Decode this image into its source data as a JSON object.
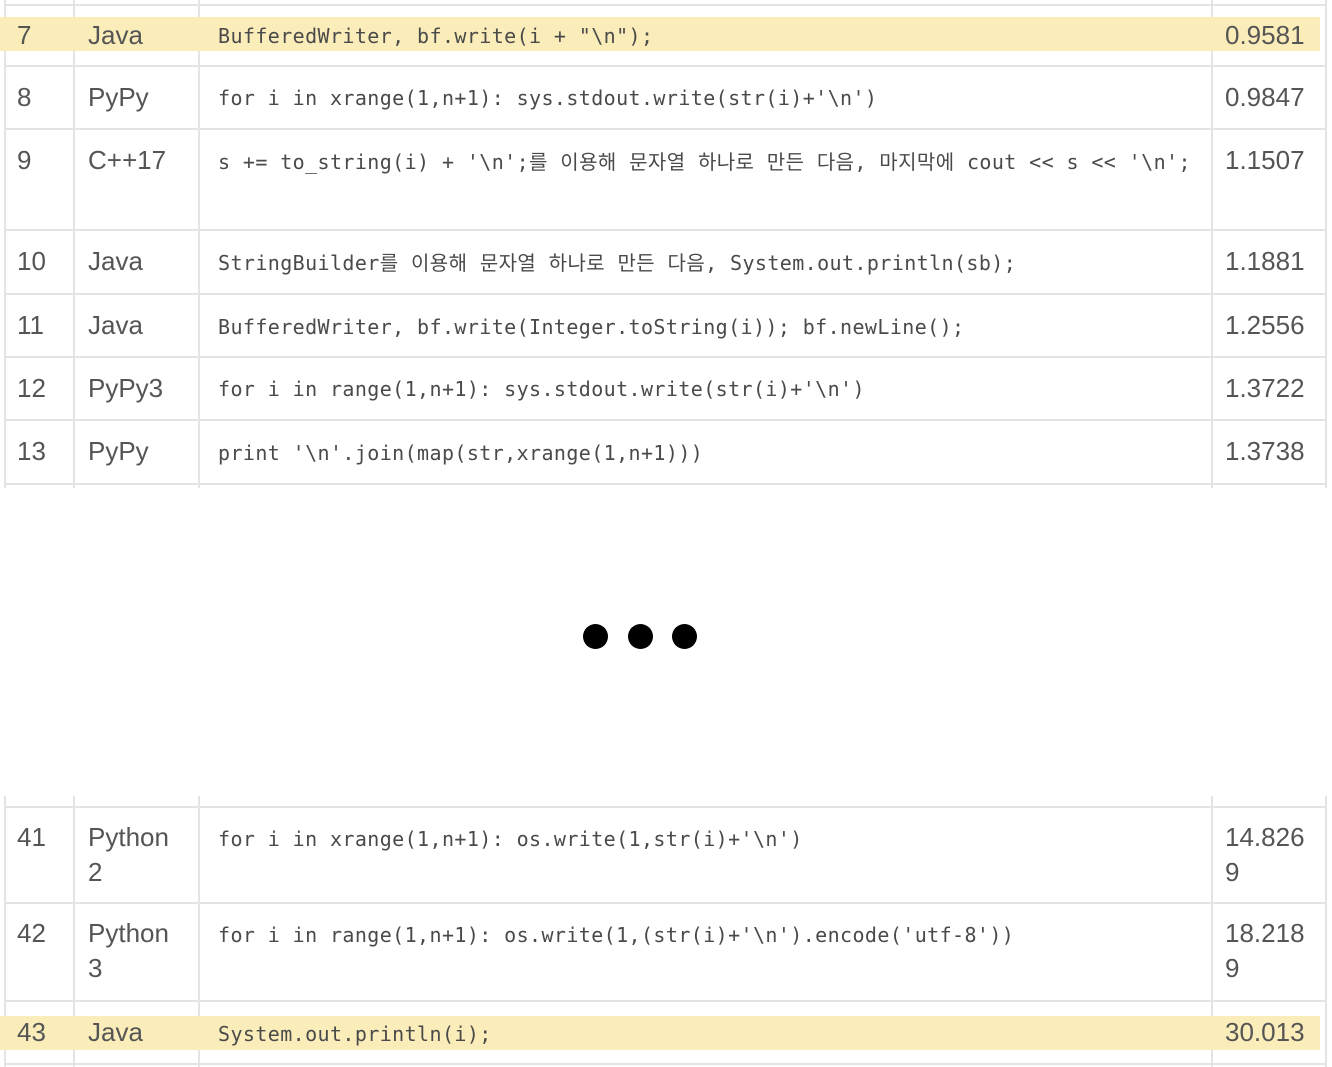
{
  "top_rows": [
    {
      "rank": "7",
      "language": "Java",
      "code": "BufferedWriter, bf.write(i + \"\\n\");",
      "time": "0.9581",
      "highlight": true
    },
    {
      "rank": "8",
      "language": "PyPy",
      "code": "for i in xrange(1,n+1): sys.stdout.write(str(i)+'\\n')",
      "time": "0.9847",
      "highlight": false
    },
    {
      "rank": "9",
      "language": "C++17",
      "code": "s += to_string(i) + '\\n';를 이용해 문자열 하나로 만든 다음, 마지막에 cout << s << '\\n';",
      "time": "1.1507",
      "highlight": false
    },
    {
      "rank": "10",
      "language": "Java",
      "code": "StringBuilder를 이용해 문자열 하나로 만든 다음, System.out.println(sb);",
      "time": "1.1881",
      "highlight": false
    },
    {
      "rank": "11",
      "language": "Java",
      "code": "BufferedWriter, bf.write(Integer.toString(i)); bf.newLine();",
      "time": "1.2556",
      "highlight": false
    },
    {
      "rank": "12",
      "language": "PyPy3",
      "code": "for i in range(1,n+1): sys.stdout.write(str(i)+'\\n')",
      "time": "1.3722",
      "highlight": false
    },
    {
      "rank": "13",
      "language": "PyPy",
      "code": "print '\\n'.join(map(str,xrange(1,n+1)))",
      "time": "1.3738",
      "highlight": false
    }
  ],
  "bottom_rows": [
    {
      "rank": "41",
      "language": "Python 2",
      "code": "for i in xrange(1,n+1): os.write(1,str(i)+'\\n')",
      "time": "14.8269",
      "highlight": false
    },
    {
      "rank": "42",
      "language": "Python 3",
      "code": "for i in range(1,n+1): os.write(1,(str(i)+'\\n').encode('utf-8'))",
      "time": "18.2189",
      "highlight": false
    },
    {
      "rank": "43",
      "language": "Java",
      "code": "System.out.println(i);",
      "time": "30.013",
      "highlight": true
    }
  ],
  "colors": {
    "highlight": "#fbedb9",
    "grid": "#e4e4e4",
    "text": "#555555",
    "ellipsis_dot": "#000000"
  },
  "icons": [
    "ellipsis-icon"
  ]
}
